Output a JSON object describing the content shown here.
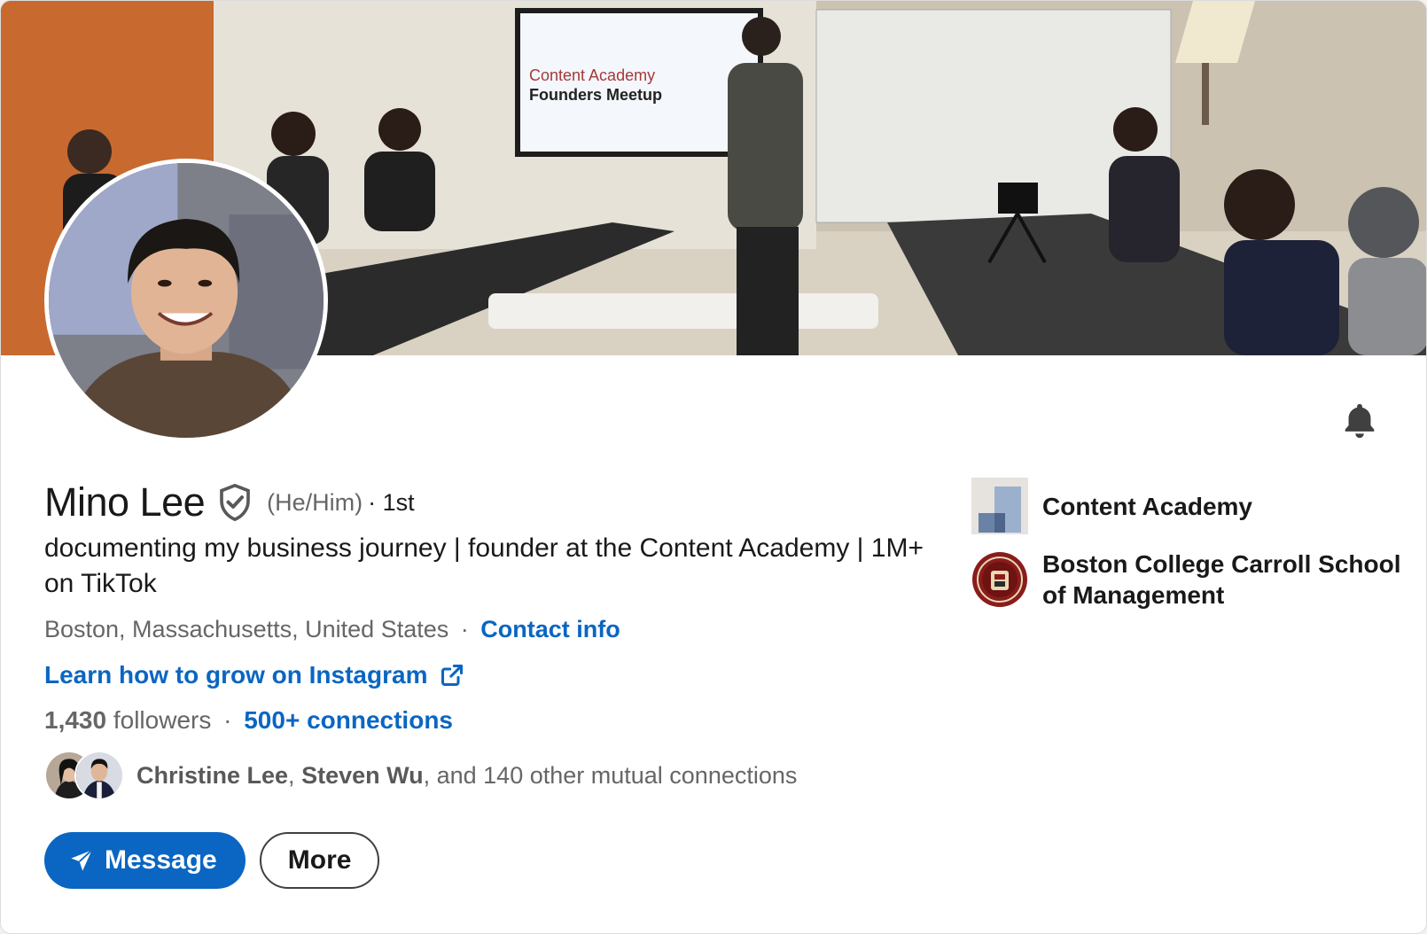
{
  "profile": {
    "name": "Mino Lee",
    "pronouns": "(He/Him)",
    "degree": "· 1st",
    "headline": "documenting my business journey | founder at the Content Academy | 1M+ on TikTok",
    "location": "Boston, Massachusetts, United States",
    "location_separator": "·",
    "contact_info_label": "Contact info",
    "website_label": "Learn how to grow on Instagram",
    "followers_count": "1,430",
    "followers_label": "followers",
    "followers_separator": "·",
    "connections_label": "500+ connections"
  },
  "cover": {
    "screen_text_line1": "Content Academy",
    "screen_text_line2": "Founders Meetup"
  },
  "mutual": {
    "names": [
      "Christine Lee",
      "Steven Wu"
    ],
    "comma": ",",
    "suffix": ", and 140 other mutual connections"
  },
  "actions": {
    "message_label": "Message",
    "more_label": "More"
  },
  "orgs": [
    {
      "name": "Content Academy"
    },
    {
      "name": "Boston College Carroll School of Management"
    }
  ],
  "icons": {
    "bell": "bell-icon",
    "verified": "verified-shield-icon",
    "external": "external-link-icon",
    "send": "paper-plane-icon"
  },
  "colors": {
    "link": "#0a66c2",
    "primary_button": "#0a66c2"
  }
}
